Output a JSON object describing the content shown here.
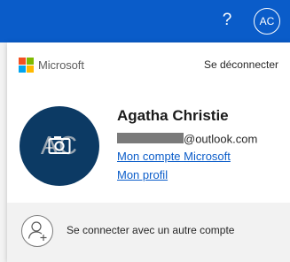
{
  "header": {
    "help_glyph": "?",
    "avatar_initials": "AC",
    "background_color": "#0a5cc9"
  },
  "account_panel": {
    "brand": {
      "name": "Microsoft",
      "logo_colors": [
        "#f25022",
        "#7fba00",
        "#00a4ef",
        "#ffb900"
      ]
    },
    "sign_out_label": "Se déconnecter",
    "avatar": {
      "initials": "AC",
      "background_color": "#0c3a64",
      "overlay_icon": "camera-icon"
    },
    "user": {
      "name": "Agatha Christie",
      "email_domain": "@outlook.com"
    },
    "links": {
      "account": "Mon compte Microsoft",
      "profile": "Mon profil"
    },
    "other_account": {
      "label": "Se connecter avec un autre compte",
      "icon": "add-user-icon"
    }
  }
}
